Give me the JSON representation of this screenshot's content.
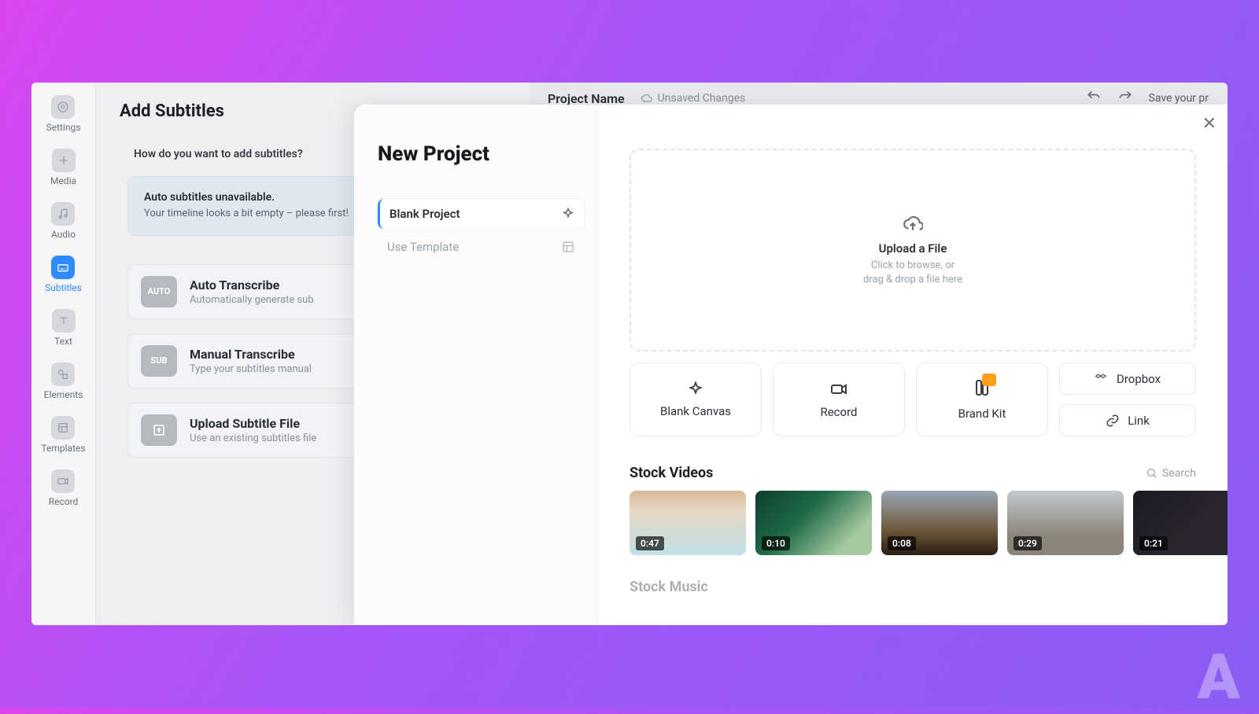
{
  "topbar": {
    "project_name": "Project Name",
    "unsaved": "Unsaved Changes",
    "save_hint": "Save your pr"
  },
  "sidebar": {
    "items": [
      {
        "label": "Settings"
      },
      {
        "label": "Media"
      },
      {
        "label": "Audio"
      },
      {
        "label": "Subtitles"
      },
      {
        "label": "Text"
      },
      {
        "label": "Elements"
      },
      {
        "label": "Templates"
      },
      {
        "label": "Record"
      }
    ]
  },
  "sub_panel": {
    "title": "Add Subtitles",
    "question": "How do you want to add subtitles?",
    "notice_title": "Auto subtitles unavailable.",
    "notice_body": "Your timeline looks a bit empty – please first!",
    "options": [
      {
        "badge": "AUTO",
        "title": "Auto Transcribe",
        "sub": "Automatically generate sub"
      },
      {
        "badge": "SUB",
        "title": "Manual Transcribe",
        "sub": "Type your subtitles manual"
      },
      {
        "badge": "",
        "title": "Upload Subtitle File",
        "sub": "Use an existing subtitles file"
      }
    ]
  },
  "modal": {
    "title": "New Project",
    "opts": [
      {
        "label": "Blank Project"
      },
      {
        "label": "Use Template"
      }
    ],
    "upload": {
      "title": "Upload a File",
      "sub": "Click to browse, or\ndrag & drop a file here"
    },
    "actions": {
      "blank": "Blank Canvas",
      "record": "Record",
      "brand": "Brand Kit",
      "dropbox": "Dropbox",
      "link": "Link"
    },
    "stock": {
      "title": "Stock Videos",
      "search": "Search",
      "videos": [
        {
          "dur": "0:47"
        },
        {
          "dur": "0:10"
        },
        {
          "dur": "0:08"
        },
        {
          "dur": "0:29"
        },
        {
          "dur": "0:21"
        }
      ],
      "next_title": "Stock Music"
    }
  }
}
